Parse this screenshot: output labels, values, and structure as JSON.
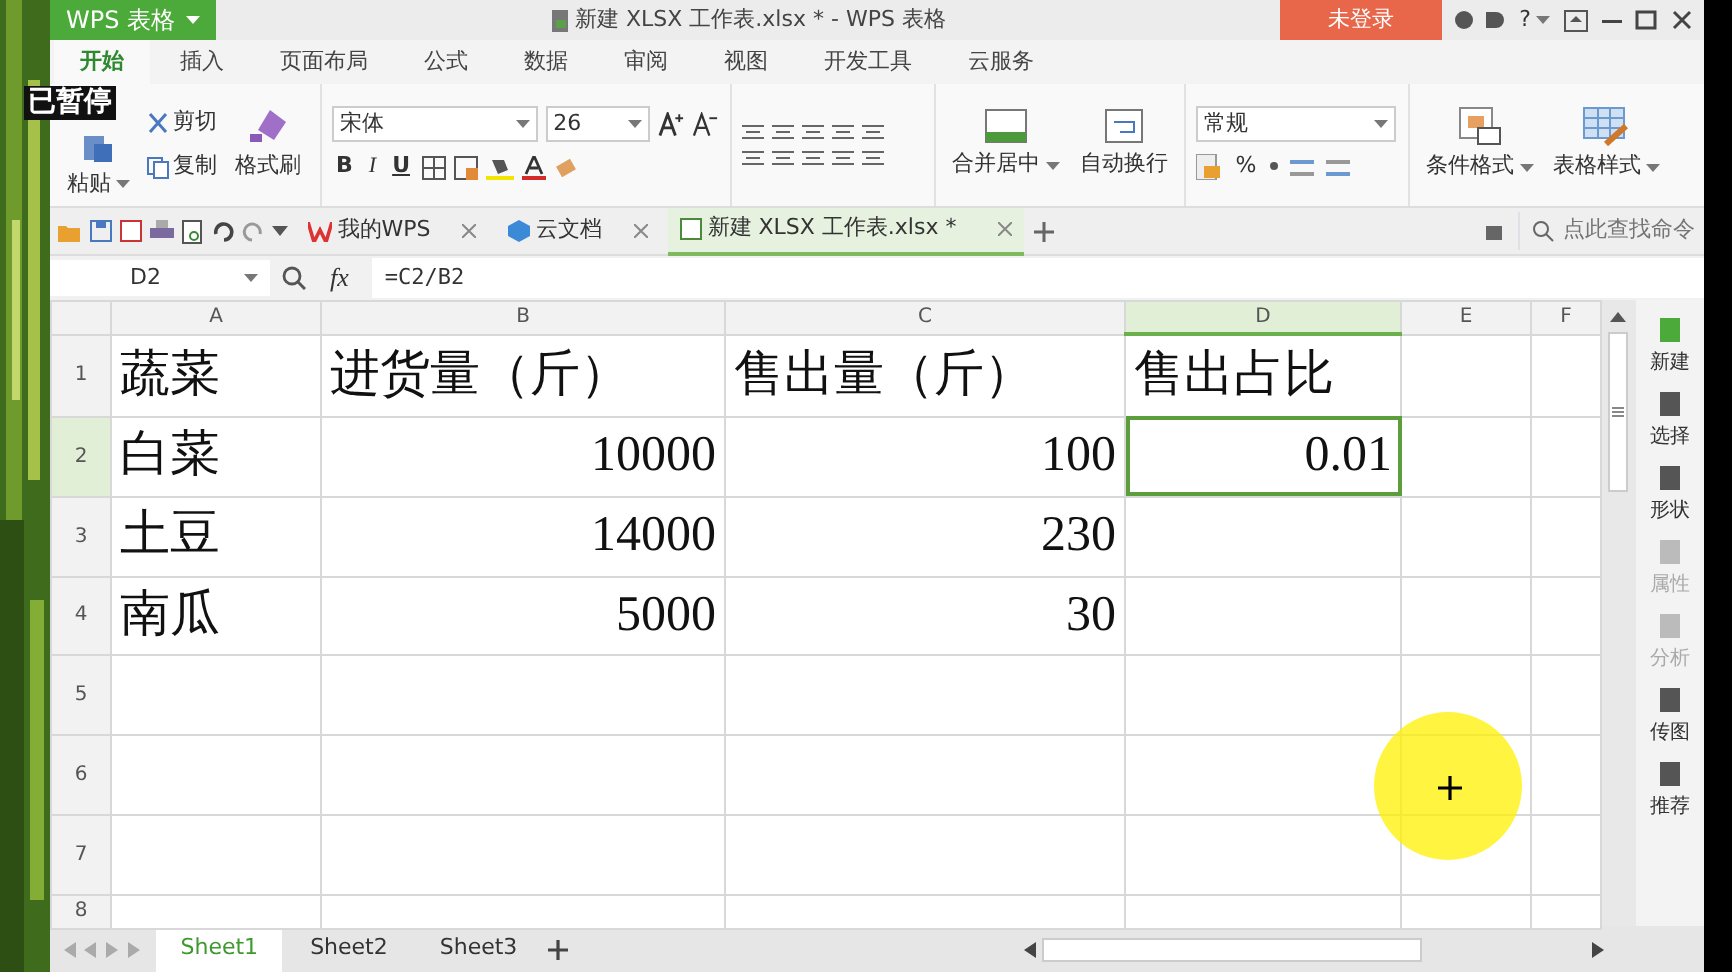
{
  "app_menu": {
    "label": "WPS 表格"
  },
  "window_title": "新建 XLSX 工作表.xlsx * - WPS 表格",
  "login_button": "未登录",
  "help_button": "?",
  "ribbon_tabs": [
    {
      "label": "开始",
      "selected": true
    },
    {
      "label": "插入",
      "selected": false
    },
    {
      "label": "页面布局",
      "selected": false
    },
    {
      "label": "公式",
      "selected": false
    },
    {
      "label": "数据",
      "selected": false
    },
    {
      "label": "审阅",
      "selected": false
    },
    {
      "label": "视图",
      "selected": false
    },
    {
      "label": "开发工具",
      "selected": false
    },
    {
      "label": "云服务",
      "selected": false
    }
  ],
  "paused_overlay": "已暂停",
  "ribbon": {
    "paste": "粘贴",
    "cut": "剪切",
    "copy": "复制",
    "format_painter": "格式刷",
    "font": "宋体",
    "font_size": "26",
    "bold": "B",
    "italic": "I",
    "underline": "U",
    "merge": "合并居中",
    "wrap": "自动换行",
    "number_format": "常规",
    "percent": "%",
    "conditional_format": "条件格式",
    "table_style": "表格样式"
  },
  "doc_tabs": [
    {
      "label": "我的WPS",
      "selected": false
    },
    {
      "label": "云文档",
      "selected": false
    },
    {
      "label": "新建 XLSX 工作表.xlsx *",
      "selected": true
    }
  ],
  "command_search": {
    "placeholder": "点此查找命令"
  },
  "name_box": "D2",
  "fx": "fx",
  "formula": "=C2/B2",
  "columns": [
    {
      "label": "A",
      "selected": false
    },
    {
      "label": "B",
      "selected": false
    },
    {
      "label": "C",
      "selected": false
    },
    {
      "label": "D",
      "selected": true
    },
    {
      "label": "E",
      "selected": false
    },
    {
      "label": "F",
      "selected": false
    }
  ],
  "rows": [
    {
      "number": "1",
      "selected": false,
      "cells": [
        "蔬菜",
        "进货量（斤）",
        "售出量（斤）",
        "售出占比"
      ]
    },
    {
      "number": "2",
      "selected": true,
      "cells": [
        "白菜",
        "10000",
        "100",
        "0.01"
      ]
    },
    {
      "number": "3",
      "selected": false,
      "cells": [
        "土豆",
        "14000",
        "230"
      ]
    },
    {
      "number": "4",
      "selected": false,
      "cells": [
        "南瓜",
        "5000",
        "30"
      ]
    },
    {
      "number": "5",
      "selected": false
    },
    {
      "number": "6",
      "selected": false
    },
    {
      "number": "7",
      "selected": false
    },
    {
      "number": "8",
      "selected": false
    }
  ],
  "sheet_tabs": [
    {
      "label": "Sheet1",
      "selected": true
    },
    {
      "label": "Sheet2",
      "selected": false
    },
    {
      "label": "Sheet3",
      "selected": false
    }
  ],
  "side_panel": [
    {
      "label": "新建",
      "disabled": false
    },
    {
      "label": "选择",
      "disabled": false
    },
    {
      "label": "形状",
      "disabled": false
    },
    {
      "label": "属性",
      "disabled": true
    },
    {
      "label": "分析",
      "disabled": true
    },
    {
      "label": "传图",
      "disabled": false
    },
    {
      "label": "推荐",
      "disabled": false
    }
  ]
}
